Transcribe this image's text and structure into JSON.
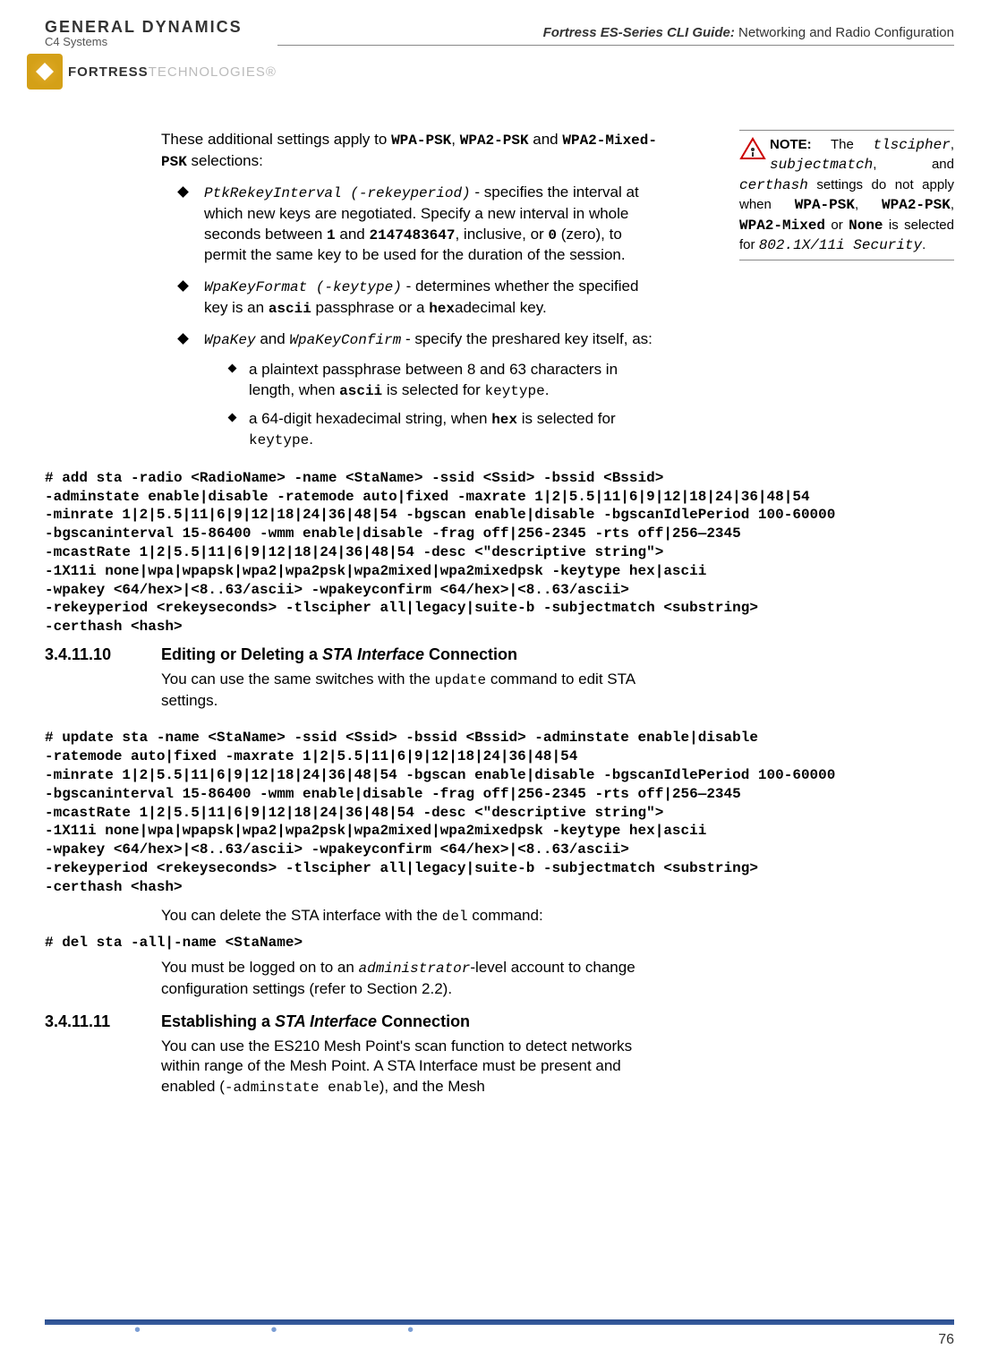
{
  "header": {
    "logo_gd": "GENERAL DYNAMICS",
    "logo_c4": "C4 Systems",
    "title_bold": "Fortress ES-Series CLI Guide:",
    "title_rest": " Networking and Radio Configuration",
    "fortress_bold": "FORTRESS",
    "fortress_tech": "TECHNOLOGIES®"
  },
  "note": {
    "label": "NOTE:",
    "text": " The tlscipher, subjectmatch, and certhash settings do not apply when WPA-PSK, WPA2-PSK, WPA2-Mixed or None is selected for 802.1X/11i Security."
  },
  "intro": {
    "p1_part1": "These additional settings apply to ",
    "p1_code1": "WPA-PSK",
    "p1_sep1": ", ",
    "p1_code2": "WPA2-PSK",
    "p1_sep2": " and ",
    "p1_code3": "WPA2-Mixed-PSK",
    "p1_part2": " selections:"
  },
  "bullets": {
    "b1_code": "PtkRekeyInterval (-rekeyperiod)",
    "b1_text1": " - specifies the interval at which new keys are negotiated. Specify a new interval in whole seconds between ",
    "b1_c1": "1",
    "b1_text2": " and ",
    "b1_c2": "2147483647",
    "b1_text3": ", inclusive, or ",
    "b1_c3": "0",
    "b1_text4": " (zero), to permit the same key to be used for the duration of the session.",
    "b2_code": "WpaKeyFormat (-keytype)",
    "b2_text1": " - determines whether the specified key is an ",
    "b2_c1": "ascii",
    "b2_text2": " passphrase or a ",
    "b2_c2": "hex",
    "b2_text3": "adecimal key.",
    "b3_code1": "WpaKey",
    "b3_text1": " and ",
    "b3_code2": "WpaKeyConfirm",
    "b3_text2": " - specify the preshared key itself, as:",
    "s1_text1": "a plaintext passphrase between 8 and 63 characters in length, when ",
    "s1_c1": "ascii",
    "s1_text2": " is selected for ",
    "s1_c2": "keytype",
    "s1_text3": ".",
    "s2_text1": "a 64-digit hexadecimal string, when ",
    "s2_c1": "hex",
    "s2_text2": " is selected for ",
    "s2_c2": "keytype",
    "s2_text3": "."
  },
  "code1": "# add sta -radio <RadioName> -name <StaName> -ssid <Ssid> -bssid <Bssid>\n-adminstate enable|disable -ratemode auto|fixed -maxrate 1|2|5.5|11|6|9|12|18|24|36|48|54\n-minrate 1|2|5.5|11|6|9|12|18|24|36|48|54 -bgscan enable|disable -bgscanIdlePeriod 100-60000\n-bgscaninterval 15-86400 -wmm enable|disable -frag off|256-2345 -rts off|256—2345\n-mcastRate 1|2|5.5|11|6|9|12|18|24|36|48|54 -desc <\"descriptive string\">\n-1X11i none|wpa|wpapsk|wpa2|wpa2psk|wpa2mixed|wpa2mixedpsk -keytype hex|ascii\n-wpakey <64/hex>|<8..63/ascii> -wpakeyconfirm <64/hex>|<8..63/ascii>\n-rekeyperiod <rekeyseconds> -tlscipher all|legacy|suite-b -subjectmatch <substring>\n-certhash <hash>",
  "section1": {
    "num": "3.4.11.10",
    "title_part1": "Editing or Deleting a ",
    "title_em": "STA Interface",
    "title_part2": " Connection",
    "p1_part1": "You can use the same switches with the ",
    "p1_code": "update",
    "p1_part2": " command to edit STA settings."
  },
  "code2": "# update sta -name <StaName> -ssid <Ssid> -bssid <Bssid> -adminstate enable|disable\n-ratemode auto|fixed -maxrate 1|2|5.5|11|6|9|12|18|24|36|48|54\n-minrate 1|2|5.5|11|6|9|12|18|24|36|48|54 -bgscan enable|disable -bgscanIdlePeriod 100-60000\n-bgscaninterval 15-86400 -wmm enable|disable -frag off|256-2345 -rts off|256—2345\n-mcastRate 1|2|5.5|11|6|9|12|18|24|36|48|54 -desc <\"descriptive string\">\n-1X11i none|wpa|wpapsk|wpa2|wpa2psk|wpa2mixed|wpa2mixedpsk -keytype hex|ascii\n-wpakey <64/hex>|<8..63/ascii> -wpakeyconfirm <64/hex>|<8..63/ascii>\n-rekeyperiod <rekeyseconds> -tlscipher all|legacy|suite-b -subjectmatch <substring>\n-certhash <hash>",
  "para_del": {
    "p1_part1": "You can delete the STA interface with the ",
    "p1_code": "del",
    "p1_part2": " command:"
  },
  "code3": "# del sta -all|-name <StaName>",
  "para_admin": {
    "p1_part1": "You must be logged on to an ",
    "p1_code": "administrator",
    "p1_part2": "-level account to change configuration settings (refer to Section 2.2)."
  },
  "section2": {
    "num": "3.4.11.11",
    "title_part1": "Establishing a ",
    "title_em": "STA Interface",
    "title_part2": " Connection",
    "p1_part1": "You can use the ES210 Mesh Point's scan function to detect networks within range of the Mesh Point. A STA Interface must be present and enabled (",
    "p1_code": "-adminstate enable",
    "p1_part2": "), and the Mesh"
  },
  "page_num": "76"
}
